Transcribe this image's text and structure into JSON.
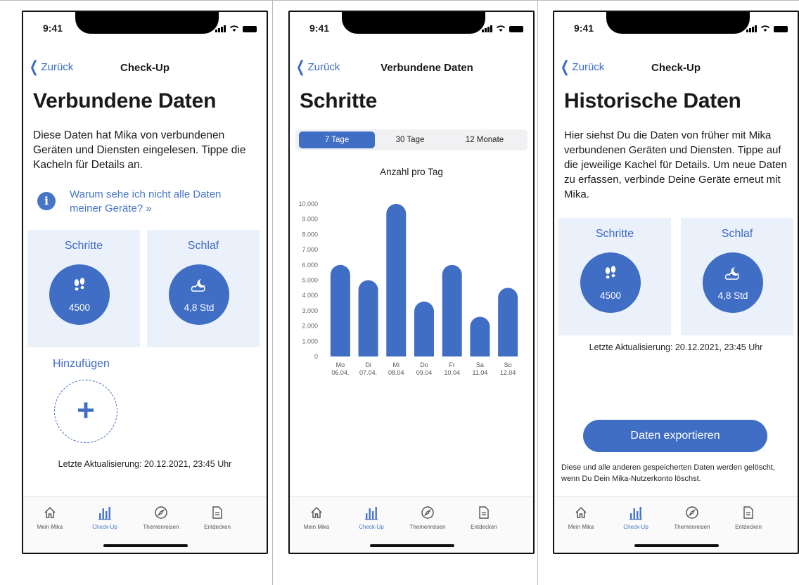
{
  "status": {
    "time": "9:41"
  },
  "tabs": [
    {
      "label": "Mein Mika",
      "icon": "home-icon"
    },
    {
      "label": "Check-Up",
      "icon": "bar-chart-icon"
    },
    {
      "label": "Themenreisen",
      "icon": "compass-icon"
    },
    {
      "label": "Entdecken",
      "icon": "document-icon"
    }
  ],
  "active_tab": "Check-Up",
  "accent_color": "#3f6ec4",
  "screen1": {
    "back_label": "Zurück",
    "nav_title": "Check-Up",
    "title": "Verbundene Daten",
    "description": "Diese Daten hat Mika von verbundenen Geräten und Diensten eingelesen. Tippe die Kacheln für Details an.",
    "info_link": "Warum sehe ich nicht alle Daten meiner Geräte? »",
    "tiles": [
      {
        "label": "Schritte",
        "value": "4500",
        "icon": "footsteps-icon"
      },
      {
        "label": "Schlaf",
        "value": "4,8 Std",
        "icon": "moon-cloud-icon"
      }
    ],
    "add_label": "Hinzufügen",
    "updated": "Letzte Aktualisierung: 20.12.2021, 23:45 Uhr"
  },
  "screen2": {
    "back_label": "Zurück",
    "nav_title": "Verbundene Daten",
    "title": "Schritte",
    "segments": [
      "7 Tage",
      "30 Tage",
      "12 Monate"
    ],
    "active_segment": "7 Tage",
    "chart_title": "Anzahl pro Tag"
  },
  "chart_data": {
    "type": "bar",
    "title": "Anzahl pro Tag",
    "categories": [
      "Mo 06.04.",
      "Di 07.04.",
      "Mi 08.04",
      "Do 09.04",
      "Fr 10.04",
      "Sa 11.04",
      "So 12.04"
    ],
    "category_day": [
      "Mo",
      "Di",
      "Mi",
      "Do",
      "Fr",
      "Sa",
      "So"
    ],
    "category_date": [
      "06.04.",
      "07.04.",
      "08.04",
      "09.04",
      "10.04",
      "11.04",
      "12.04"
    ],
    "values": [
      6000,
      5000,
      10000,
      3600,
      6000,
      2600,
      4500
    ],
    "ylim": [
      0,
      10000
    ],
    "yticks": [
      "0",
      "1.000",
      "2.000",
      "3.000",
      "4.000",
      "5.000",
      "6.000",
      "7.000",
      "8.000",
      "9.000",
      "10.000"
    ],
    "xlabel": "",
    "ylabel": "",
    "grid": false,
    "bar_color": "#3f6ec4"
  },
  "screen3": {
    "back_label": "Zurück",
    "nav_title": "Check-Up",
    "title": "Historische Daten",
    "description": "Hier siehst Du die Daten von früher mit Mika verbundenen Geräten und Diensten. Tippe auf die jeweilige Kachel für Details. Um neue Daten zu erfassen, verbinde Deine Geräte erneut mit Mika.",
    "tiles": [
      {
        "label": "Schritte",
        "value": "4500",
        "icon": "footsteps-icon"
      },
      {
        "label": "Schlaf",
        "value": "4,8 Std",
        "icon": "moon-cloud-icon"
      }
    ],
    "updated": "Letzte Aktualisierung: 20.12.2021, 23:45 Uhr",
    "export_button": "Daten exportieren",
    "footnote": "Diese und alle anderen gespeicherten Daten werden gelöscht, wenn Du Dein Mika-Nutzerkonto löschst."
  }
}
